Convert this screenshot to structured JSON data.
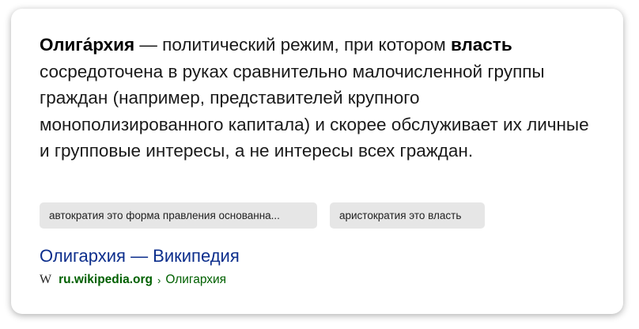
{
  "definition": {
    "term": "Олига́рхия",
    "part1": " — политический режим, при котором ",
    "highlight": "власть",
    "part2": " сосредоточена в руках сравнительно малочисленной группы граждан (например, представителей крупного монополизированного капитала) и скорее обслуживает их личные и групповые интересы, а не интересы всех граждан."
  },
  "related_queries": [
    "автократия это форма правления основанна...",
    "аристократия это власть"
  ],
  "source": {
    "title": "Олигархия — Википедия",
    "icon": "wikipedia-icon",
    "icon_glyph": "W",
    "domain": "ru.wikipedia.org",
    "separator": "›",
    "breadcrumb": "Олигархия"
  },
  "colors": {
    "link": "#0c2e8c",
    "url_green": "#006000",
    "chip_bg": "#e6e6e6"
  }
}
